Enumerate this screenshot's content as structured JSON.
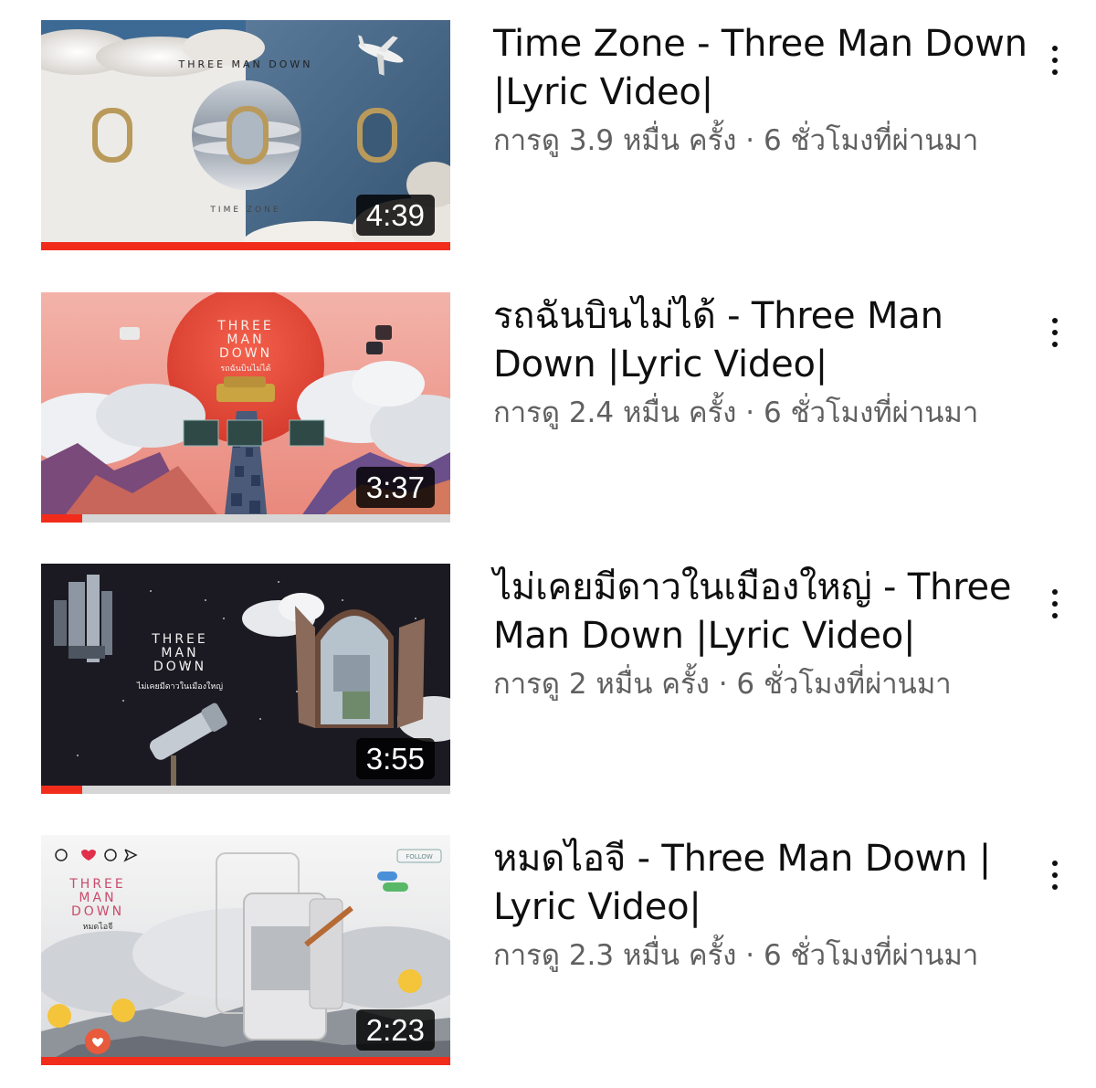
{
  "colors": {
    "progress": "#f12c1b",
    "title": "#0f0f0f",
    "meta": "#606060"
  },
  "videos": [
    {
      "title": "Time Zone - Three Man Down |Lyric Video|",
      "views": "การดู 3.9 หมื่น ครั้ง",
      "separator": "·",
      "age": "6 ชั่วโมงที่ผ่านมา",
      "duration": "4:39",
      "watched_fraction": 1.0,
      "thumb_text": [
        "THREE MAN DOWN",
        "TIME ZONE"
      ],
      "menu_icon": "more-vert-icon"
    },
    {
      "title": "รถฉันบินไม่ได้ - Three Man Down |Lyric Video|",
      "views": "การดู 2.4 หมื่น ครั้ง",
      "separator": "·",
      "age": "6 ชั่วโมงที่ผ่านมา",
      "duration": "3:37",
      "watched_fraction": 0.1,
      "thumb_text": [
        "THREE",
        "MAN",
        "DOWN",
        "รถฉันบินไม่ได้"
      ],
      "menu_icon": "more-vert-icon"
    },
    {
      "title": "ไม่เคยมีดาวในเมืองใหญ่ - Three Man Down |Lyric Video|",
      "views": "การดู 2 หมื่น ครั้ง",
      "separator": "·",
      "age": "6 ชั่วโมงที่ผ่านมา",
      "duration": "3:55",
      "watched_fraction": 0.1,
      "thumb_text": [
        "THREE",
        "MAN",
        "DOWN",
        "ไม่เคยมีดาวในเมืองใหญ่"
      ],
      "menu_icon": "more-vert-icon"
    },
    {
      "title": "หมดไอจี - Three Man Down | Lyric Video|",
      "views": "การดู 2.3 หมื่น ครั้ง",
      "separator": "·",
      "age": "6 ชั่วโมงที่ผ่านมา",
      "duration": "2:23",
      "watched_fraction": 1.0,
      "thumb_text": [
        "THREE",
        "MAN",
        "DOWN",
        "หมดไอจี",
        "FOLLOW"
      ],
      "menu_icon": "more-vert-icon"
    }
  ]
}
